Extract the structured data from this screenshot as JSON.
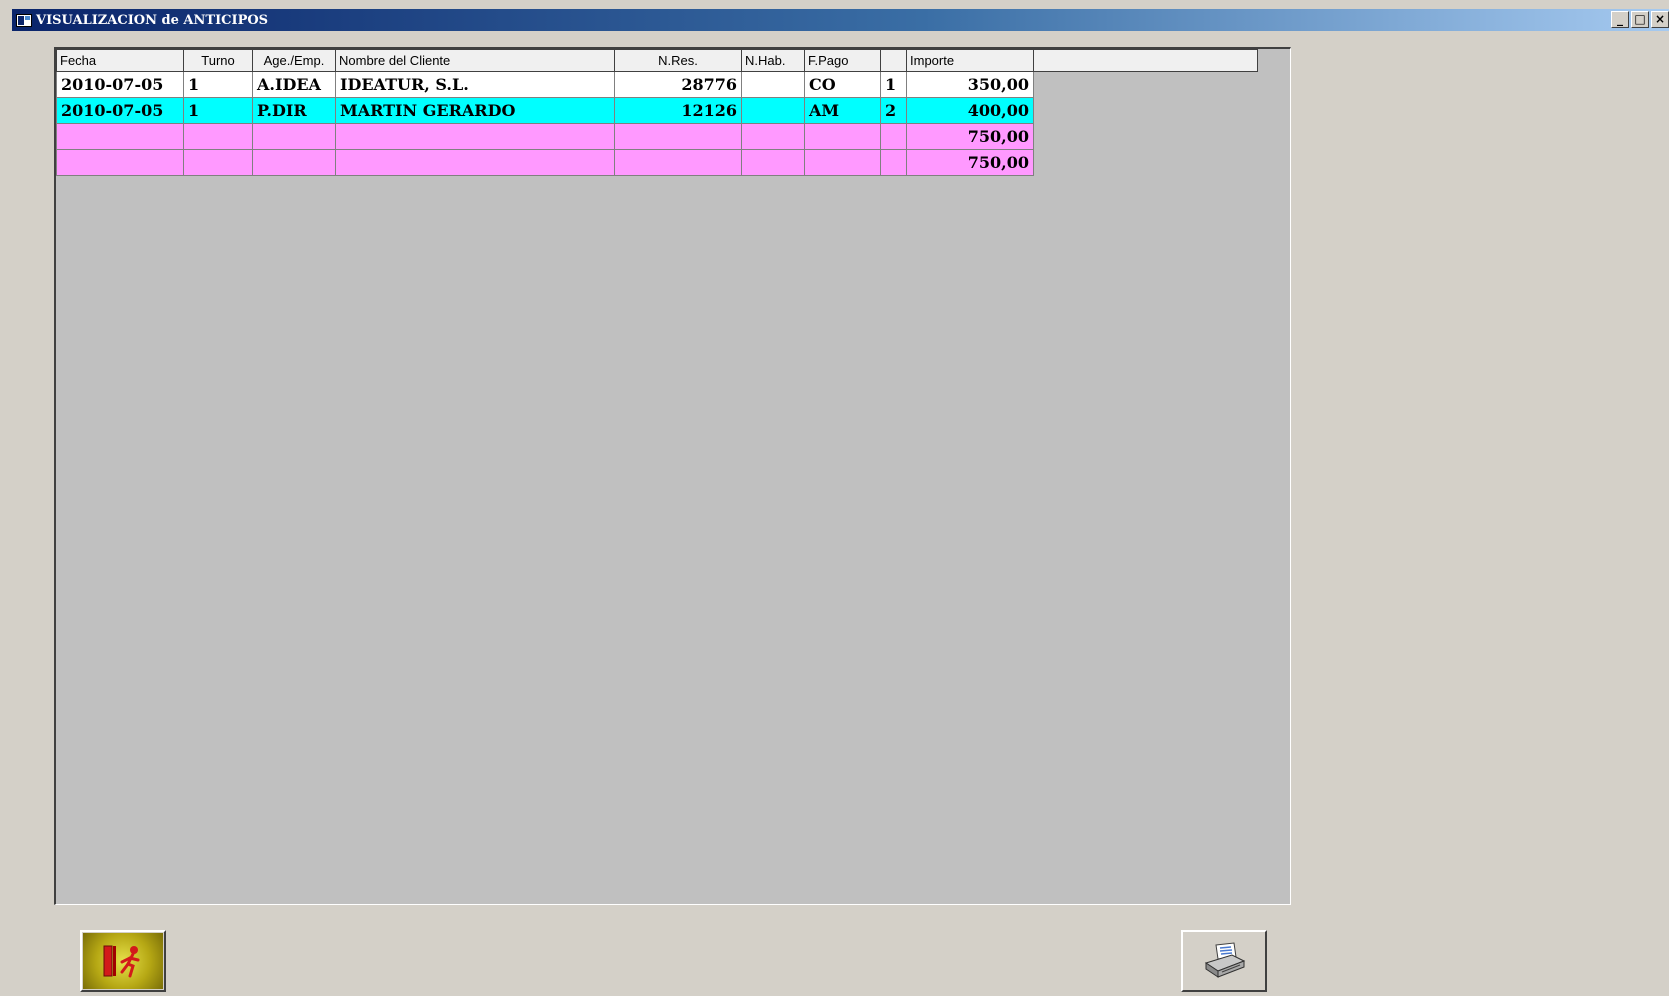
{
  "window": {
    "title": "VISUALIZACION de ANTICIPOS",
    "controls": {
      "minimize": "_",
      "maximize": "□",
      "close": "×"
    }
  },
  "grid": {
    "columns": [
      "Fecha",
      "Turno",
      "Age./Emp.",
      "Nombre del Cliente",
      "N.Res.",
      "N.Hab.",
      "F.Pago",
      "",
      "Importe",
      ""
    ],
    "rows": [
      {
        "fecha": "2010-07-05",
        "turno": "1",
        "age": "A.IDEA",
        "cliente": "IDEATUR, S.L.",
        "nres": "28776",
        "nhab": "",
        "fpago": "CO",
        "num": "1",
        "importe": "350,00"
      },
      {
        "fecha": "2010-07-05",
        "turno": "1",
        "age": "P.DIR",
        "cliente": "MARTIN GERARDO",
        "nres": "12126",
        "nhab": "",
        "fpago": "AM",
        "num": "2",
        "importe": "400,00"
      }
    ],
    "totals": [
      "750,00",
      "750,00"
    ]
  },
  "buttons": {
    "exit_icon": "exit-door-icon",
    "print_icon": "printer-icon"
  },
  "colors": {
    "row_selected": "#00ffff",
    "row_total": "#ff99ff",
    "grid_background": "#c0c0c0"
  }
}
